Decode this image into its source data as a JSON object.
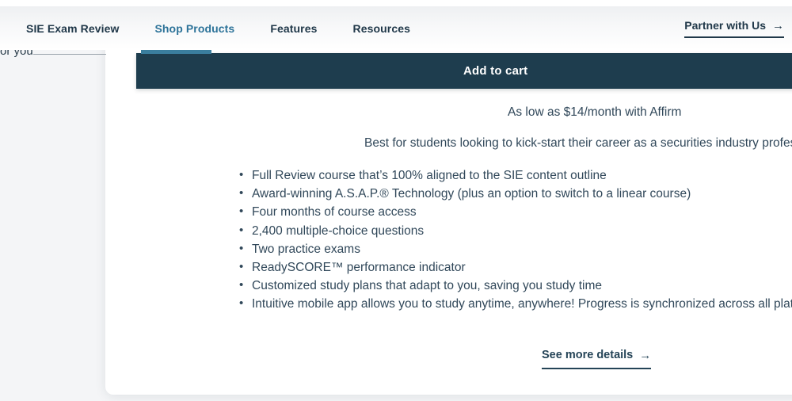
{
  "nav": {
    "items": [
      {
        "label": "SIE Exam Review",
        "active": false
      },
      {
        "label": "Shop Products",
        "active": true
      },
      {
        "label": "Features",
        "active": false
      },
      {
        "label": "Resources",
        "active": false
      }
    ],
    "cta": {
      "label": "Partner with Us",
      "arrow_icon": "arrow-right-icon",
      "arrow": "→"
    },
    "active_indicator_color": "#3a7e9e",
    "active_text_color": "#2d7399"
  },
  "clipped_left_text": "or you",
  "product": {
    "add_to_cart_label": "Add to cart",
    "add_to_cart_color": "#1e3d4e",
    "financing_text": "As low as $14/month with Affirm",
    "tagline": "Best for students looking to kick-start their career as a securities industry professional",
    "features": [
      "Full Review course that’s 100% aligned to the SIE content outline",
      "Award-winning A.S.A.P.® Technology (plus an option to switch to a linear course)",
      "Four months of course access",
      "2,400 multiple-choice questions",
      "Two practice exams",
      "ReadySCORE™ performance indicator",
      "Customized study plans that adapt to you, saving you study time",
      "Intuitive mobile app allows you to study anytime, anywhere! Progress is synchronized across all platforms"
    ],
    "see_more": {
      "label": "See more details",
      "arrow_icon": "arrow-right-icon",
      "arrow": "→"
    }
  },
  "theme": {
    "page_background": "#f4f5f7",
    "card_background": "#ffffff",
    "body_text": "#31485a",
    "nav_text": "#203849"
  }
}
